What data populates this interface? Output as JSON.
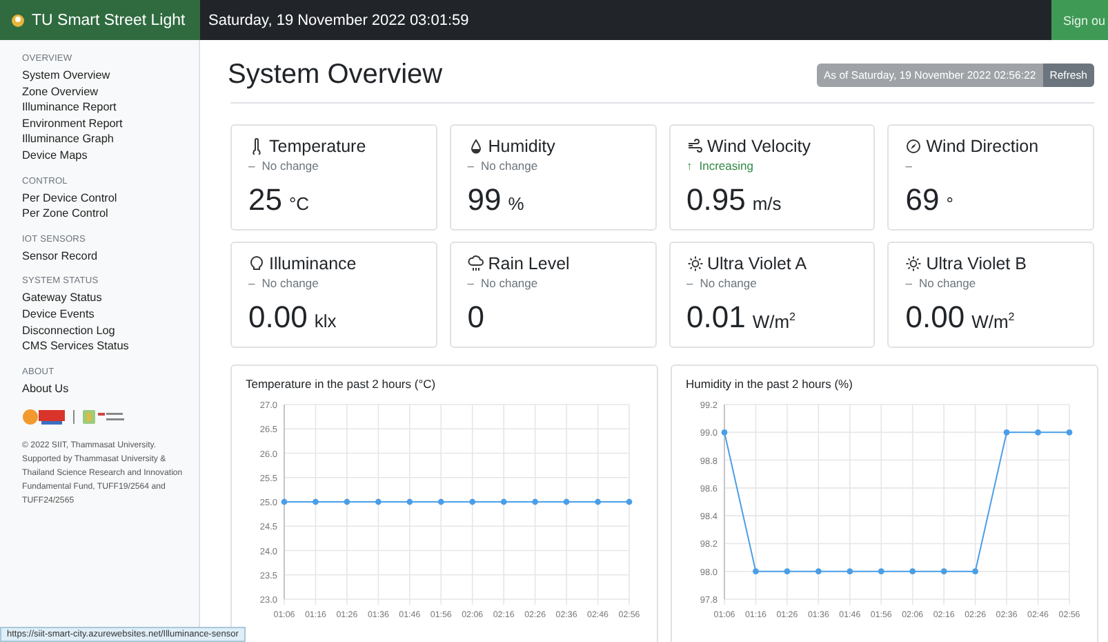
{
  "header": {
    "brand": "TU Smart Street Light",
    "datetime": "Saturday, 19 November 2022 03:01:59",
    "sign_out": "Sign ou"
  },
  "sidebar": {
    "sections": [
      {
        "heading": "OVERVIEW",
        "items": [
          {
            "label": "System Overview",
            "selected": false
          },
          {
            "label": "Zone Overview",
            "selected": false
          },
          {
            "label": "Illuminance Report",
            "selected": false
          },
          {
            "label": "Environment Report",
            "selected": false
          },
          {
            "label": "Illuminance Graph",
            "selected": false
          },
          {
            "label": "Device Maps",
            "selected": false
          }
        ]
      },
      {
        "heading": "CONTROL",
        "items": [
          {
            "label": "Per Device Control",
            "selected": false
          },
          {
            "label": "Per Zone Control",
            "selected": false
          }
        ]
      },
      {
        "heading": "IOT SENSORS",
        "items": [
          {
            "label": "Sensor Record",
            "selected": false
          }
        ]
      },
      {
        "heading": "SYSTEM STATUS",
        "items": [
          {
            "label": "Gateway Status",
            "selected": false
          },
          {
            "label": "Device Events",
            "selected": false
          },
          {
            "label": "Disconnection Log",
            "selected": false
          },
          {
            "label": "CMS Services Status",
            "selected": false
          }
        ]
      },
      {
        "heading": "ABOUT",
        "items": [
          {
            "label": "About Us",
            "selected": false
          }
        ]
      }
    ],
    "footer": "© 2022 SIIT, Thammasat University. Supported by Thammasat University & Thailand Science Research and Innovation Fundamental Fund, TUFF19/2564 and TUFF24/2565"
  },
  "page": {
    "title": "System Overview",
    "as_of": "As of Saturday, 19 November 2022 02:56:22",
    "refresh": "Refresh"
  },
  "cards": [
    {
      "kind": "thermometer",
      "title": "Temperature",
      "trend": {
        "kind": "flat",
        "symbol": "–",
        "text": "No change"
      },
      "value": "25",
      "unit": "°C"
    },
    {
      "kind": "droplet",
      "title": "Humidity",
      "trend": {
        "kind": "flat",
        "symbol": "–",
        "text": "No change"
      },
      "value": "99",
      "unit": "%"
    },
    {
      "kind": "wind",
      "title": "Wind Velocity",
      "trend": {
        "kind": "up",
        "symbol": "↑",
        "text": "Increasing"
      },
      "value": "0.95",
      "unit": "m/s"
    },
    {
      "kind": "compass",
      "title": "Wind Direction",
      "trend": {
        "kind": "flat",
        "symbol": "–"
      },
      "value": "69",
      "unit": "°"
    },
    {
      "kind": "bulb",
      "title": "Illuminance",
      "trend": {
        "kind": "flat",
        "symbol": "–",
        "text": "No change"
      },
      "value": "0.00",
      "unit": "klx"
    },
    {
      "kind": "rain",
      "title": "Rain Level",
      "trend": {
        "kind": "flat",
        "symbol": "–",
        "text": "No change"
      },
      "value": "0"
    },
    {
      "kind": "sun",
      "title": "Ultra Violet A",
      "trend": {
        "kind": "flat",
        "symbol": "–",
        "text": "No change"
      },
      "value": "0.01",
      "unit": "W/m$^{2}$"
    },
    {
      "kind": "sun",
      "title": "Ultra Violet B",
      "trend": {
        "kind": "flat",
        "symbol": "–",
        "text": "No change"
      },
      "value": "0.00",
      "unit": "W/m$^{2}$"
    }
  ],
  "charts": [
    {
      "title": "Temperature in the past 2 hours (°C)",
      "chart_data": {
        "type": "line",
        "categories": [
          "01:06",
          "01:16",
          "01:26",
          "01:36",
          "01:46",
          "01:56",
          "02:06",
          "02:16",
          "02:26",
          "02:36",
          "02:46",
          "02:56"
        ],
        "grid": true,
        "series": [
          {
            "color": "#4a9ee8",
            "marker": true,
            "values": [
              25,
              25,
              25,
              25,
              25,
              25,
              25,
              25,
              25,
              25,
              25,
              25
            ]
          }
        ],
        "ylim": [
          23,
          27
        ],
        "yticks": [
          {
            "value": 23,
            "label": "23.0"
          },
          {
            "value": 23.5,
            "label": "23.5"
          },
          {
            "value": 24,
            "label": "24.0"
          },
          {
            "value": 24.5,
            "label": "24.5"
          },
          {
            "value": 25,
            "label": "25.0"
          },
          {
            "value": 25.5,
            "label": "25.5"
          },
          {
            "value": 26,
            "label": "26.0"
          },
          {
            "value": 26.5,
            "label": "26.5"
          },
          {
            "value": 27,
            "label": "27.0"
          }
        ]
      }
    },
    {
      "title": "Humidity in the past 2 hours (%)",
      "chart_data": {
        "type": "line",
        "categories": [
          "01:06",
          "01:16",
          "01:26",
          "01:36",
          "01:46",
          "01:56",
          "02:06",
          "02:16",
          "02:26",
          "02:36",
          "02:46",
          "02:56"
        ],
        "grid": true,
        "series": [
          {
            "color": "#4a9ee8",
            "marker": true,
            "values": [
              99,
              98,
              98,
              98,
              98,
              98,
              98,
              98,
              98,
              99,
              99,
              99
            ]
          }
        ],
        "ylim": [
          97.8,
          99.2
        ],
        "yticks": [
          {
            "value": 97.8,
            "label": "97.8"
          },
          {
            "value": 98,
            "label": "98.0"
          },
          {
            "value": 98.2,
            "label": "98.2"
          },
          {
            "value": 98.4,
            "label": "98.4"
          },
          {
            "value": 98.6,
            "label": "98.6"
          },
          {
            "value": 98.8,
            "label": "98.8"
          },
          {
            "value": 99,
            "label": "99.0"
          },
          {
            "value": 99.2,
            "label": "99.2"
          }
        ]
      }
    }
  ],
  "status_url": "https://siit-smart-city.azurewebsites.net/Illuminance-sensor"
}
